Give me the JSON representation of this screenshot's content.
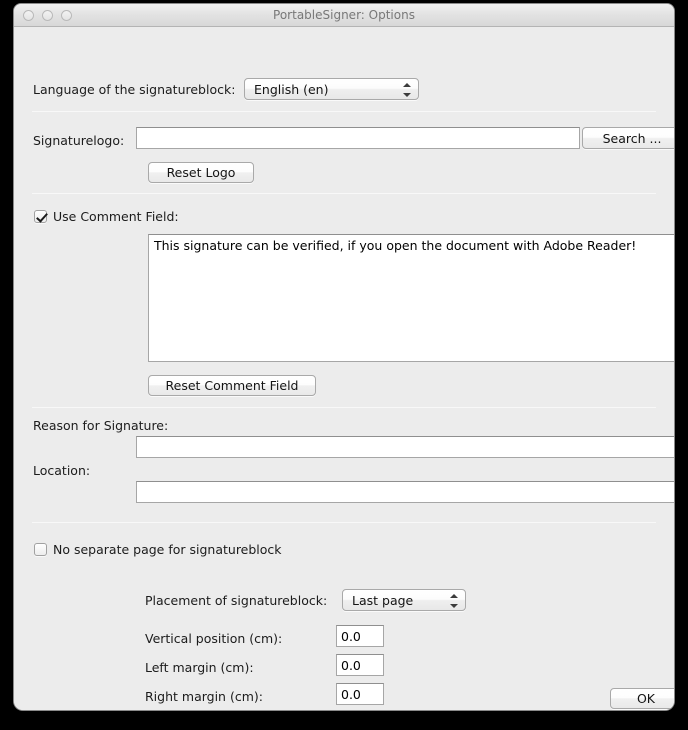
{
  "window": {
    "title": "PortableSigner: Options",
    "traffic_lights": [
      "close-button",
      "minimize-button",
      "zoom-button"
    ]
  },
  "language_row": {
    "label": "Language of the signatureblock:",
    "selected": "English (en)",
    "options": [
      "English (en)"
    ]
  },
  "logo_row": {
    "label": "Signaturelogo:",
    "value": "",
    "placeholder": "",
    "search_button": "Search ...",
    "reset_button": "Reset Logo"
  },
  "comment_section": {
    "checkbox_label": "Use Comment Field:",
    "checked": true,
    "text": "This signature can be verified, if you open the document with Adobe Reader!",
    "reset_button": "Reset Comment Field"
  },
  "reason_row": {
    "label": "Reason for Signature:",
    "value": "",
    "placeholder": ""
  },
  "location_row": {
    "label": "Location:",
    "value": "",
    "placeholder": ""
  },
  "page_section": {
    "checkbox_label": "No separate page for signatureblock",
    "checked": false,
    "placement_label": "Placement of signatureblock:",
    "placement_selected": "Last page",
    "placement_options": [
      "Last page"
    ],
    "fields": [
      {
        "label": "Vertical position (cm):",
        "value": "0.0"
      },
      {
        "label": "Left margin (cm):",
        "value": "0.0"
      },
      {
        "label": "Right margin (cm):",
        "value": "0.0"
      }
    ]
  },
  "footer": {
    "ok_button": "OK"
  }
}
